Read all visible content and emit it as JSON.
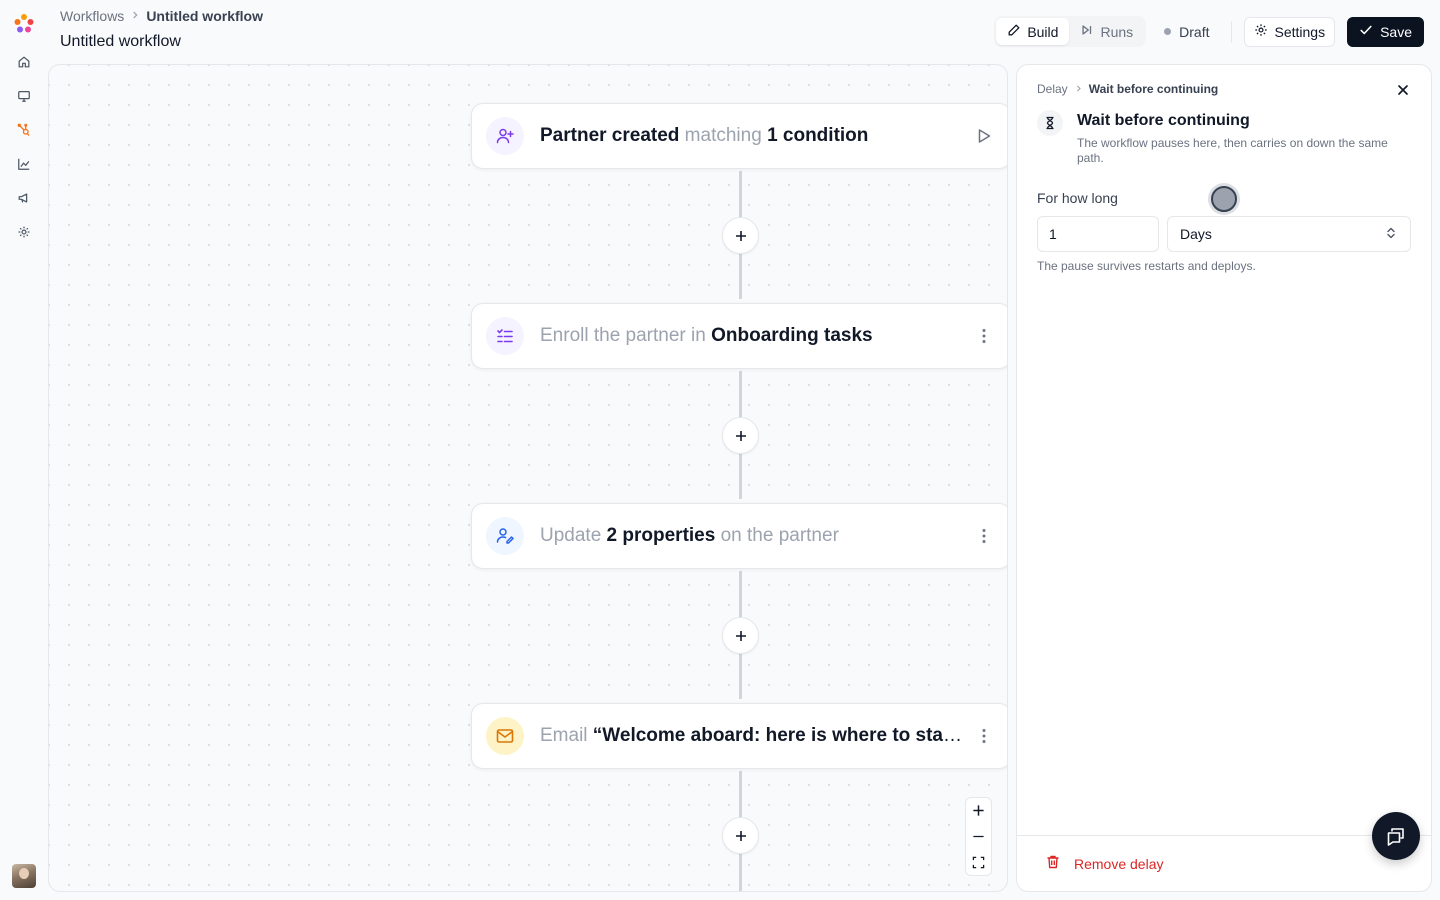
{
  "header": {
    "breadcrumb": {
      "root": "Workflows",
      "current": "Untitled workflow"
    },
    "title": "Untitled workflow",
    "tabs": [
      {
        "label": "Build",
        "active": true
      },
      {
        "label": "Runs",
        "active": false
      }
    ],
    "status": "Draft",
    "settings_label": "Settings",
    "save_label": "Save"
  },
  "nodes": [
    {
      "icon": "user-plus-icon",
      "color": "#7c3aed",
      "parts": [
        {
          "text": "Partner created",
          "style": "strong"
        },
        {
          "text": " matching ",
          "style": "muted"
        },
        {
          "text": "1 condition",
          "style": "strong"
        }
      ],
      "action": "play"
    },
    {
      "icon": "checklist-icon",
      "color": "#7c3aed",
      "parts": [
        {
          "text": "Enroll the partner in ",
          "style": "muted"
        },
        {
          "text": "Onboarding tasks",
          "style": "strong"
        }
      ],
      "action": "menu"
    },
    {
      "icon": "user-edit-icon",
      "color": "#2563eb",
      "parts": [
        {
          "text": "Update ",
          "style": "muted"
        },
        {
          "text": "2 properties",
          "style": "strong"
        },
        {
          "text": " on the partner",
          "style": "muted"
        }
      ],
      "action": "menu"
    },
    {
      "icon": "mail-icon",
      "color": "#d97706",
      "parts": [
        {
          "text": "Email ",
          "style": "muted"
        },
        {
          "text": "“Welcome aboard: here is where to start”",
          "style": "strong"
        }
      ],
      "action": "menu"
    }
  ],
  "panel": {
    "breadcrumb": {
      "root": "Delay",
      "current": "Wait before continuing"
    },
    "title": "Wait before continuing",
    "description": "The workflow pauses here, then carries on down the same path.",
    "duration_label": "For how long",
    "duration_value": "1",
    "unit_value": "Days",
    "hint": "The pause survives restarts and deploys.",
    "remove_label": "Remove delay"
  },
  "colors": {
    "brand_dark": "#0b1220",
    "danger": "#dc2626",
    "accent_purple": "#7c3aed",
    "accent_blue": "#2563eb",
    "accent_amber": "#d97706"
  }
}
